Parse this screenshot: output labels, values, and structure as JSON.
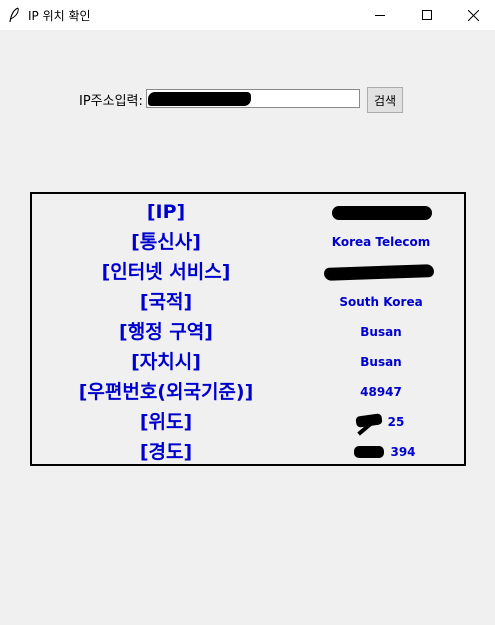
{
  "window": {
    "title": "IP 위치 확인",
    "icon": "feather-icon"
  },
  "form": {
    "label": "IP주소입력:",
    "input_value": "",
    "search_label": "검색"
  },
  "results": {
    "rows": [
      {
        "label": "[IP]",
        "value": ""
      },
      {
        "label": "[통신사]",
        "value": "Korea Telecom"
      },
      {
        "label": "[인터넷 서비스]",
        "value": ""
      },
      {
        "label": "[국적]",
        "value": "South Korea"
      },
      {
        "label": "[행정 구역]",
        "value": "Busan"
      },
      {
        "label": "[자치시]",
        "value": "Busan"
      },
      {
        "label": "[우편번호(외국기준)]",
        "value": "48947"
      },
      {
        "label": "[위도]",
        "value": "25"
      },
      {
        "label": "[경도]",
        "value": "394"
      }
    ]
  },
  "colors": {
    "label_color": "#0000cd",
    "redaction": "#000000"
  }
}
